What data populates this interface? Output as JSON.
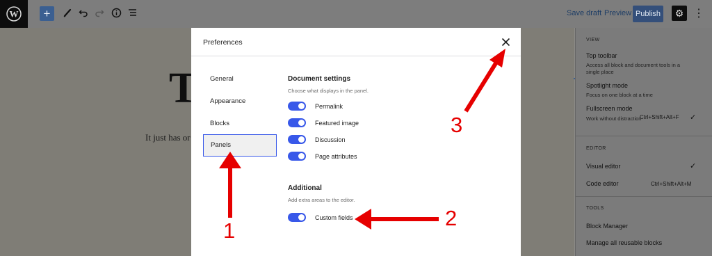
{
  "toolbar": {
    "logo_icon": "wordpress-logo-icon",
    "add_block_label": "+",
    "save_draft_label": "Save draft",
    "preview_label": "Preview",
    "publish_label": "Publish",
    "settings_icon": "gear-icon",
    "more_icon": "more-vertical-icon"
  },
  "canvas": {
    "heading_visible": "T",
    "paragraph_visible": "It just has or"
  },
  "settings_menu": {
    "view": {
      "title": "VIEW",
      "items": [
        {
          "label": "Top toolbar",
          "description": "Access all block and document tools in a single place"
        },
        {
          "label": "Spotlight mode",
          "description": "Focus on one block at a time"
        },
        {
          "label": "Fullscreen mode",
          "description": "Work without distraction",
          "shortcut": "Ctrl+Shift+Alt+F",
          "checked": "✓"
        }
      ]
    },
    "editor": {
      "title": "EDITOR",
      "items": [
        {
          "label": "Visual editor",
          "checked": "✓"
        },
        {
          "label": "Code editor",
          "shortcut": "Ctrl+Shift+Alt+M"
        }
      ]
    },
    "tools": {
      "title": "TOOLS",
      "items": [
        {
          "label": "Block Manager"
        },
        {
          "label": "Manage all reusable blocks"
        }
      ]
    }
  },
  "preferences": {
    "title": "Preferences",
    "close_icon": "close-icon",
    "nav": [
      {
        "label": "General"
      },
      {
        "label": "Appearance"
      },
      {
        "label": "Blocks"
      },
      {
        "label": "Panels",
        "active": true
      }
    ],
    "document_settings": {
      "title": "Document settings",
      "description": "Choose what displays in the panel.",
      "toggles": [
        {
          "label": "Permalink",
          "on": true
        },
        {
          "label": "Featured image",
          "on": true
        },
        {
          "label": "Discussion",
          "on": true
        },
        {
          "label": "Page attributes",
          "on": true
        }
      ]
    },
    "additional": {
      "title": "Additional",
      "description": "Add extra areas to the editor.",
      "toggles": [
        {
          "label": "Custom fields",
          "on": true
        }
      ]
    }
  },
  "annotations": {
    "color": "#e60000",
    "labels": [
      "1",
      "2",
      "3"
    ]
  },
  "colors": {
    "accent": "#3858e9",
    "annotation_red": "#e60000"
  }
}
